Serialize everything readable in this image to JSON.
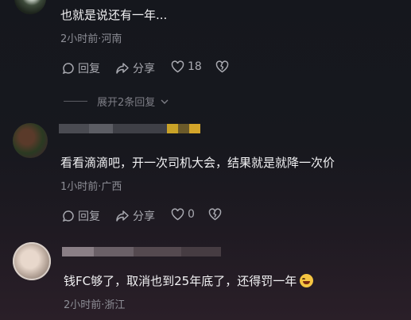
{
  "comments": [
    {
      "text": "也就是说还有一年...",
      "meta": "2小时前·河南",
      "reply_label": "回复",
      "share_label": "分享",
      "likes": "18"
    },
    {
      "text": "看看滴滴吧，开一次司机大会，结果就是就降一次价",
      "meta": "1小时前·广西",
      "reply_label": "回复",
      "share_label": "分享",
      "likes": "0"
    },
    {
      "text": "钱FC够了，取消也到25年底了，还得罚一年",
      "meta": "2小时前·浙江"
    }
  ],
  "expand_replies": "展开2条回复",
  "colors": {
    "background_top": "#15171d",
    "background_bottom": "#2a1f28",
    "meta": "#8d8e96",
    "text": "#f1f1f3"
  }
}
